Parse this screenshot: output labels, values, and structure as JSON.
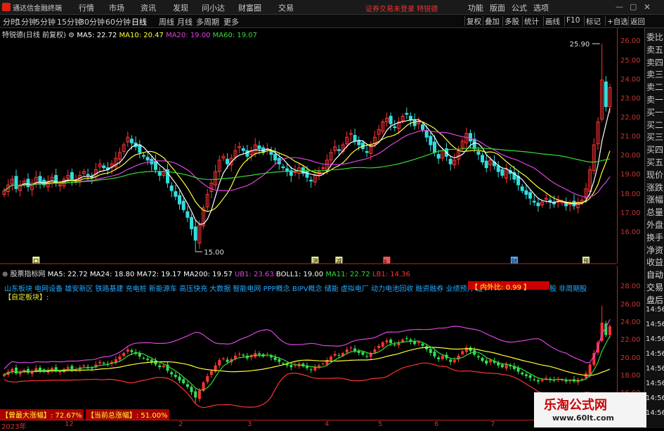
{
  "app": {
    "title": "通达信金融终端",
    "login_status": "证券交易未登录 特锐德"
  },
  "menu": [
    "行情",
    "市场",
    "资讯",
    "发现",
    "问小达",
    "财富圈",
    "交易"
  ],
  "right_menu": [
    "功能",
    "版面",
    "公式",
    "选项"
  ],
  "periods": [
    "分时",
    "1分钟",
    "5分钟",
    "15分钟",
    "30分钟",
    "60分钟",
    "日线",
    "周线",
    "月线",
    "多周期",
    "更多"
  ],
  "active_period": "日线",
  "tools": [
    "复权",
    "叠加",
    "多股",
    "统计",
    "画线",
    "F10",
    "标记",
    "+自选",
    "返回"
  ],
  "main_chart": {
    "stock_label": "特锐德(日线 前复权)",
    "ma": [
      {
        "label": "MA5: 22.72",
        "color": "#ffffff"
      },
      {
        "label": "MA10: 20.47",
        "color": "#ffff33"
      },
      {
        "label": "MA20: 19.00",
        "color": "#dd44dd"
      },
      {
        "label": "MA60: 19.07",
        "color": "#33dd33"
      }
    ],
    "high_label": "25.90",
    "low_label": "15.00",
    "price_ticks": [
      "26.00",
      "25.00",
      "24.00",
      "23.00",
      "22.00",
      "21.00",
      "20.00",
      "19.00",
      "18.00",
      "17.00",
      "16.00"
    ],
    "markers": [
      "口",
      "测",
      "减",
      "s",
      "财",
      "预"
    ]
  },
  "side_panel": [
    "委比",
    "卖五",
    "卖四",
    "卖三",
    "卖二",
    "卖一",
    "买一",
    "买二",
    "买三",
    "买四",
    "买五",
    "现价",
    "涨跌",
    "涨幅",
    "总量",
    "外盘",
    "换手",
    "净资",
    "收益",
    "自动",
    "交易",
    "盘后"
  ],
  "lower_chart": {
    "indicator_name": "股票指标网",
    "lines": [
      {
        "label": "MA5: 22.72",
        "color": "#ffffff"
      },
      {
        "label": "MA24: 18.80",
        "color": "#ffffff"
      },
      {
        "label": "MA72: 19.17",
        "color": "#ffffff"
      },
      {
        "label": "MA200: 19.57",
        "color": "#ffffff"
      },
      {
        "label": "UB1: 23.63",
        "color": "#dd44dd"
      },
      {
        "label": "BOLL1: 19.00",
        "color": "#ffffff"
      },
      {
        "label": "MA11: 22.72",
        "color": "#33dd33"
      },
      {
        "label": "LB1: 14.36",
        "color": "#ff3333"
      }
    ],
    "sectors": "山东板块 电网设备 雄安新区 铁路基建 充电桩 新能源车 高压快充 大数据 智能电网 PPP概念 BIPV概念 储能 虚拟电厂 动力电池回收 融资融券 业绩预升 证",
    "sectors_tail": "股 非周期股",
    "custom_sector": "【自定板块】:",
    "inner_outer_ratio": "【 内外比: 0.99 】",
    "axis_ticks": [
      "28.00",
      "26.00",
      "24.00",
      "22.00",
      "20.00",
      "18.00",
      "16.00"
    ],
    "right_times": [
      "14:56",
      "14:56",
      "14:56",
      "14:56",
      "14:56",
      "14:56",
      "14:56",
      "14:56"
    ]
  },
  "bottom_stats": {
    "max_gain": "【曾最大涨幅】: 72.67%",
    "current_gain": "【当前总涨幅】: 51.00%"
  },
  "date_axis": [
    "2023年",
    "12",
    "2",
    "3",
    "4",
    "5",
    "6",
    "7",
    "8"
  ],
  "watermark": {
    "title": "乐淘公式网",
    "url": "www.60lt.com"
  },
  "colors": {
    "up": "#ff3333",
    "down": "#33dddd",
    "axis": "#cc3333",
    "background": "#000000"
  },
  "chart_data": {
    "type": "candlestick",
    "ylim": [
      15.0,
      26.2
    ],
    "close": [
      18.2,
      18.5,
      18.8,
      18.3,
      18.5,
      18.7,
      18.4,
      18.6,
      18.9,
      18.6,
      18.5,
      18.7,
      18.9,
      18.6,
      18.5,
      18.8,
      19.0,
      18.8,
      18.7,
      19.0,
      19.2,
      19.0,
      18.9,
      19.3,
      19.6,
      19.4,
      19.3,
      19.6,
      19.9,
      20.2,
      20.6,
      21.0,
      20.7,
      20.5,
      20.2,
      20.0,
      19.8,
      19.6,
      19.3,
      19.0,
      19.2,
      18.6,
      18.2,
      17.9,
      17.5,
      17.2,
      16.8,
      16.2,
      15.6,
      16.4,
      17.3,
      18.0,
      18.6,
      19.2,
      19.8,
      20.0,
      19.6,
      19.9,
      20.3,
      20.5,
      20.3,
      20.0,
      20.3,
      20.6,
      20.4,
      20.2,
      20.4,
      20.1,
      19.8,
      19.6,
      19.4,
      19.2,
      19.0,
      19.2,
      19.4,
      19.1,
      18.9,
      18.7,
      19.0,
      19.2,
      19.4,
      19.8,
      20.2,
      20.5,
      20.3,
      20.6,
      21.0,
      21.2,
      20.8,
      20.6,
      20.4,
      20.2,
      20.6,
      21.0,
      21.4,
      21.8,
      22.0,
      21.7,
      21.5,
      21.8,
      22.1,
      22.2,
      21.9,
      21.6,
      21.8,
      21.4,
      21.0,
      20.6,
      20.2,
      19.9,
      20.3,
      20.0,
      19.6,
      19.8,
      20.3,
      20.8,
      21.2,
      20.8,
      20.4,
      20.1,
      19.7,
      19.4,
      19.8,
      19.5,
      19.2,
      19.0,
      19.3,
      19.1,
      18.8,
      18.5,
      18.2,
      18.0,
      17.8,
      17.6,
      17.4,
      17.6,
      17.8,
      17.6,
      17.5,
      17.7,
      17.6,
      17.4,
      17.5,
      17.4,
      17.6,
      17.7,
      18.3,
      19.3,
      20.6,
      21.8,
      24.0,
      22.6,
      23.6
    ]
  }
}
